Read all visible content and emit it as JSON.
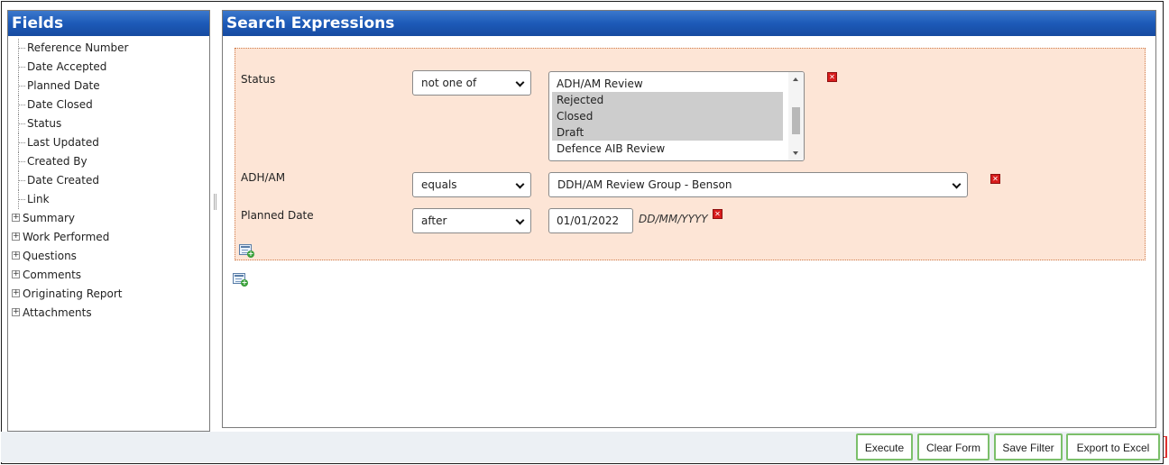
{
  "fields_panel": {
    "title": "Fields",
    "items": [
      {
        "label": "Reference Number",
        "expandable": false
      },
      {
        "label": "Date Accepted",
        "expandable": false
      },
      {
        "label": "Planned Date",
        "expandable": false
      },
      {
        "label": "Date Closed",
        "expandable": false
      },
      {
        "label": "Status",
        "expandable": false
      },
      {
        "label": "Last Updated",
        "expandable": false
      },
      {
        "label": "Created By",
        "expandable": false
      },
      {
        "label": "Date Created",
        "expandable": false
      },
      {
        "label": "Link",
        "expandable": false
      },
      {
        "label": "Summary",
        "expandable": true
      },
      {
        "label": "Work Performed",
        "expandable": true
      },
      {
        "label": "Questions",
        "expandable": true
      },
      {
        "label": "Comments",
        "expandable": true
      },
      {
        "label": "Originating Report",
        "expandable": true
      },
      {
        "label": "Attachments",
        "expandable": true
      }
    ]
  },
  "search_panel": {
    "title": "Search Expressions",
    "expressions": {
      "status": {
        "label": "Status",
        "operator": "not one of",
        "options": [
          {
            "label": "ADH/AM Review",
            "selected": false
          },
          {
            "label": "Rejected",
            "selected": true
          },
          {
            "label": "Closed",
            "selected": true
          },
          {
            "label": "Draft",
            "selected": true
          },
          {
            "label": "Defence AIB Review",
            "selected": false
          }
        ]
      },
      "adh_am": {
        "label": "ADH/AM",
        "operator": "equals",
        "value": "DDH/AM Review Group - Benson"
      },
      "planned_date": {
        "label": "Planned Date",
        "operator": "after",
        "value": "01/01/2022",
        "format_hint": "DD/MM/YYYY"
      }
    }
  },
  "footer": {
    "buttons": {
      "execute": "Execute",
      "clear_form": "Clear Form",
      "save_filter": "Save Filter",
      "export_excel": "Export to Excel"
    }
  },
  "colors": {
    "header_blue": "#1d5ab8",
    "expression_bg": "#fde5d6",
    "delete_red": "#d81c1c",
    "button_border_green": "#7bbf6a"
  }
}
